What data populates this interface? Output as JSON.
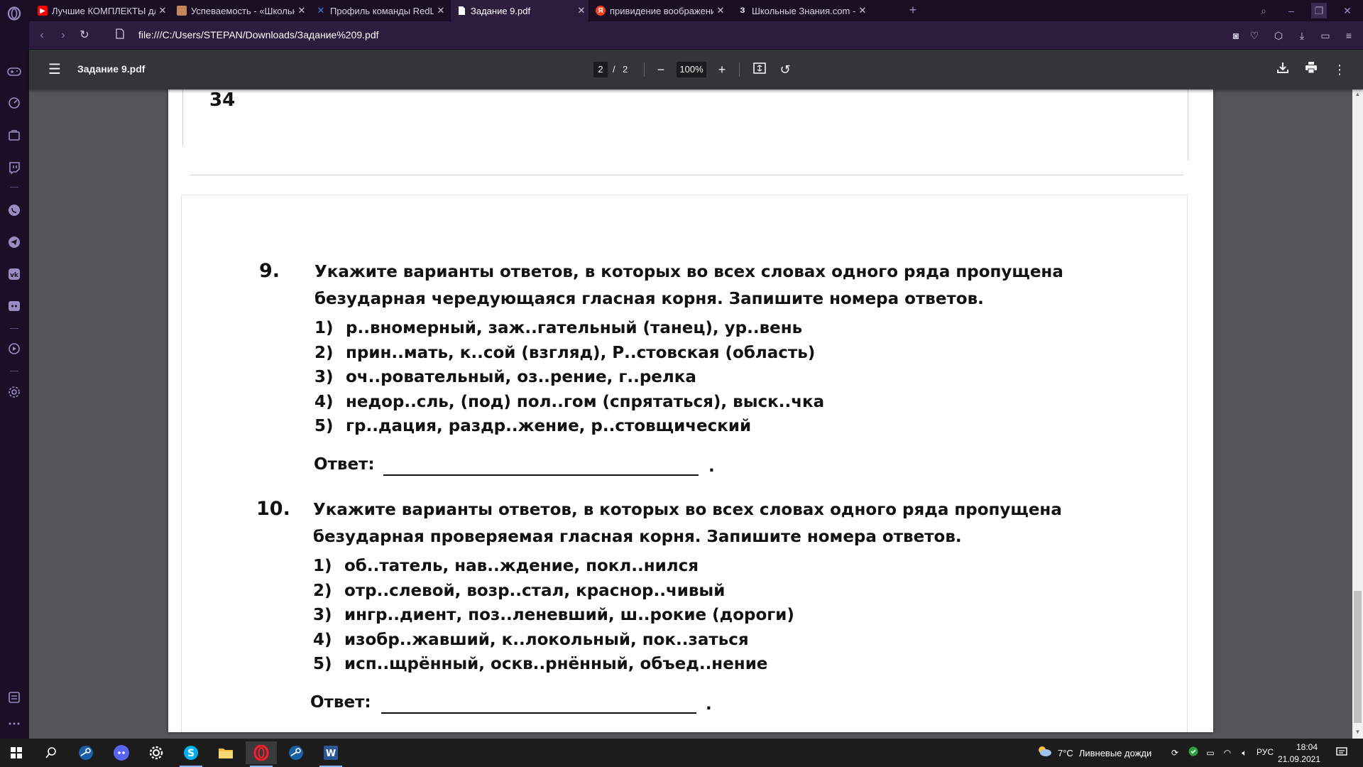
{
  "browser": {
    "tabs": [
      {
        "title": "Лучшие КОМПЛЕКТЫ для",
        "favicon": "youtube-icon",
        "color": "#ff0000",
        "glyph": "▶"
      },
      {
        "title": "Успеваемость - «Школьн",
        "favicon": "school-icon",
        "color": "#c5845a",
        "glyph": "▮"
      },
      {
        "title": "Профиль команды RedLat",
        "favicon": "redlab-icon",
        "color": "#4a7fd6",
        "glyph": "✕"
      },
      {
        "title": "Задание 9.pdf",
        "favicon": "pdf-file-icon",
        "color": "#ffffff",
        "glyph": "▯"
      },
      {
        "title": "привидение воображени",
        "favicon": "yandex-icon",
        "color": "#fc3f1d",
        "glyph": "Я"
      },
      {
        "title": "Школьные Знания.com - F",
        "favicon": "znania-icon",
        "color": "#1a0e24",
        "glyph": "З"
      }
    ],
    "url": "file:///C:/Users/STEPAN/Downloads/Задание%209.pdf"
  },
  "pdf": {
    "title": "Задание 9.pdf",
    "page_current": "2",
    "page_sep": "/",
    "page_total": "2",
    "zoom": "100%"
  },
  "document": {
    "page_number": "34",
    "q9": {
      "num": "9.",
      "text": "Укажите варианты ответов, в которых во всех словах одного ряда пропущена безударная чередующаяся гласная корня. Запишите номера ответов.",
      "options": [
        {
          "n": "1)",
          "t": "р..вномерный, заж..гательный (танец), ур..вень"
        },
        {
          "n": "2)",
          "t": "прин..мать, к..сой (взгляд), Р..стовская (область)"
        },
        {
          "n": "3)",
          "t": "оч..ровательный, оз..рение, г..релка"
        },
        {
          "n": "4)",
          "t": "недор..сль, (под) пол..гом (спрятаться), выск..чка"
        },
        {
          "n": "5)",
          "t": "гр..дация, раздр..жение, р..стовщический"
        }
      ],
      "answer_label": "Ответ:",
      "answer_dot": "."
    },
    "q10": {
      "num": "10.",
      "text": "Укажите варианты ответов, в которых во всех словах одного ряда пропущена безударная проверяемая гласная корня. Запишите номера ответов.",
      "options": [
        {
          "n": "1)",
          "t": "об..татель, нав..ждение, покл..нился"
        },
        {
          "n": "2)",
          "t": "отр..слевой, возр..стал, краснор..чивый"
        },
        {
          "n": "3)",
          "t": "ингр..диент, поз..леневший, ш..рокие (дороги)"
        },
        {
          "n": "4)",
          "t": "изобр..жавший, к..локольный, пок..заться"
        },
        {
          "n": "5)",
          "t": "исп..щрённый, оскв..рнённый, объед..нение"
        }
      ],
      "answer_label": "Ответ:",
      "answer_dot": "."
    }
  },
  "taskbar": {
    "weather_temp": "7°C",
    "weather_desc": "Ливневые дожди",
    "lang": "РУС",
    "time": "18:04",
    "date": "21.09.2021"
  },
  "colors": {
    "browser_bg": "#1a0e24",
    "active_tab": "#2c1c3e",
    "pdf_toolbar": "#323639",
    "viewer_bg": "#525659",
    "taskbar": "#1c1c1c"
  }
}
